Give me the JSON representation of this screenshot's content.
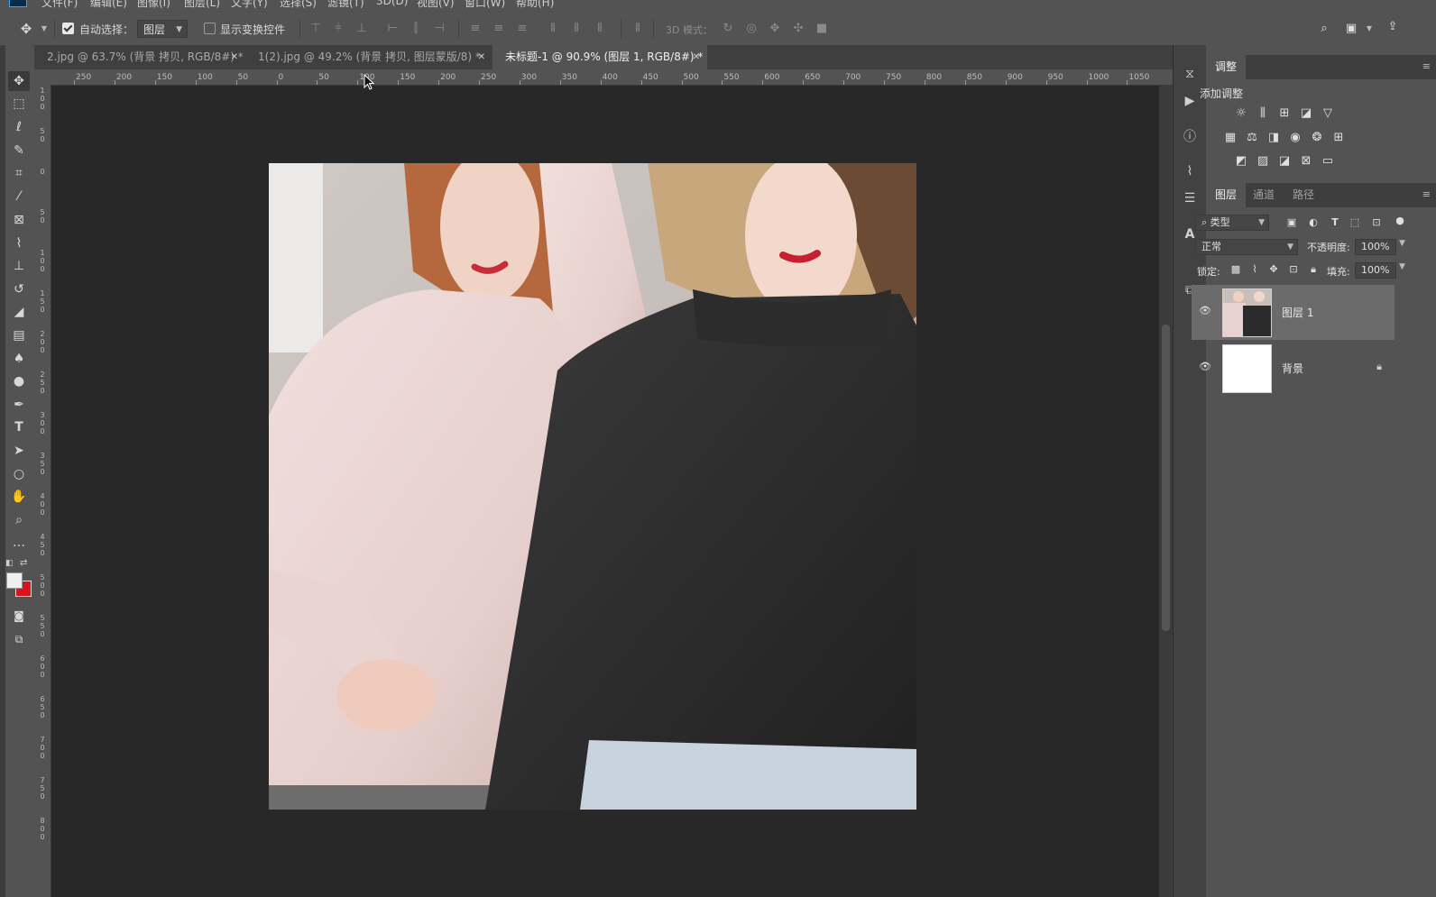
{
  "menubar": {
    "items": [
      "文件(F)",
      "编辑(E)",
      "图像(I)",
      "图层(L)",
      "文字(Y)",
      "选择(S)",
      "滤镜(T)",
      "3D(D)",
      "视图(V)",
      "窗口(W)",
      "帮助(H)"
    ]
  },
  "options_bar": {
    "auto_select_label": "自动选择：",
    "auto_select_checked": true,
    "auto_select_target": "图层",
    "show_transform_label": "显示变换控件",
    "show_transform_checked": false,
    "mode_3d_label": "3D 模式："
  },
  "tabs": [
    {
      "label": "2.jpg @ 63.7% (背景 拷贝, RGB/8#) *",
      "active": false
    },
    {
      "label": "1(2).jpg @ 49.2% (背景 拷贝, 图层蒙版/8) *",
      "active": false
    },
    {
      "label": "未标题-1 @ 90.9% (图层 1, RGB/8#) *",
      "active": true
    }
  ],
  "ruler": {
    "h_ticks": [
      "250",
      "200",
      "150",
      "100",
      "50",
      "0",
      "50",
      "100",
      "150",
      "200",
      "250",
      "300",
      "350",
      "400",
      "450",
      "500",
      "550",
      "600",
      "650",
      "700",
      "750",
      "800",
      "850",
      "900",
      "950",
      "1000",
      "1050"
    ],
    "v_ticks": [
      "100",
      "50",
      "0",
      "50",
      "100",
      "150",
      "200",
      "250",
      "300",
      "350",
      "400",
      "450",
      "500",
      "550",
      "600",
      "650",
      "700",
      "750",
      "800"
    ]
  },
  "tools": [
    "move",
    "marquee",
    "lasso",
    "quick-select",
    "crop",
    "eyedropper",
    "frame",
    "brush",
    "stamp",
    "history-brush",
    "eraser",
    "gradient",
    "smudge",
    "dodge",
    "pen",
    "type",
    "path-select",
    "ellipse",
    "hand",
    "zoom",
    "more"
  ],
  "adjustments_panel": {
    "tab": "调整",
    "add_label": "添加调整"
  },
  "layers_panel": {
    "tabs": [
      "图层",
      "通道",
      "路径"
    ],
    "filter_label": "类型",
    "blend_mode": "正常",
    "opacity_label": "不透明度:",
    "opacity_value": "100%",
    "lock_label": "锁定:",
    "fill_label": "填充:",
    "fill_value": "100%",
    "layers": [
      {
        "name": "图层 1",
        "selected": true,
        "locked": false
      },
      {
        "name": "背景",
        "selected": false,
        "locked": true
      }
    ]
  },
  "icons": {
    "eye": "eye-icon",
    "lock": "lock-icon",
    "search": "search-icon",
    "share": "share-icon"
  },
  "colors": {
    "foreground": "#efefef",
    "background": "#d8141c"
  }
}
